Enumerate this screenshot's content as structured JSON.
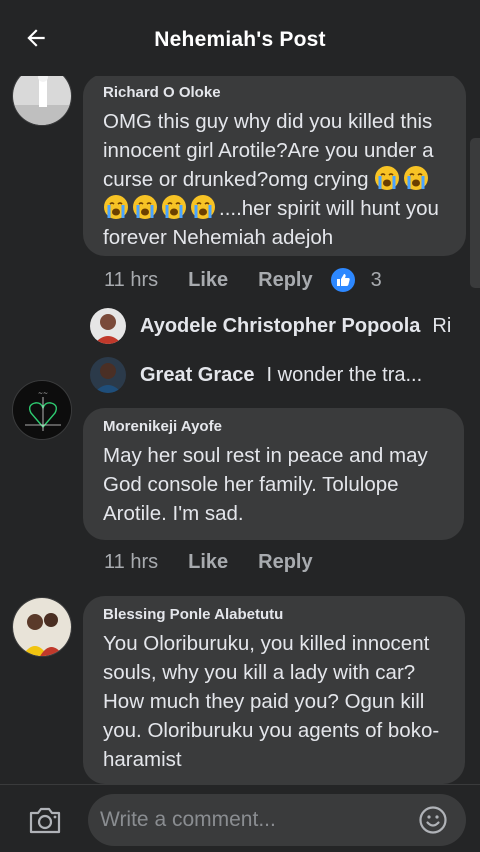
{
  "header": {
    "title": "Nehemiah's Post",
    "back_icon": "back-arrow-icon"
  },
  "comments": [
    {
      "author": "Richard O Oloke",
      "text_before_emoji": "OMG this guy why did you killed this innocent girl Arotile?Are you under a curse or drunked?omg crying",
      "emoji": "loudly-crying-face",
      "emoji_count": 6,
      "text_after_emoji": "....her spirit will hunt you forever Nehemiah adejoh",
      "time": "11 hrs",
      "like_label": "Like",
      "reply_label": "Reply",
      "reaction_count": "3",
      "replies": [
        {
          "name": "Ayodele Christopher Popoola",
          "text": "Ri"
        },
        {
          "name": "Great Grace",
          "text": "I wonder the tra..."
        }
      ]
    },
    {
      "author": "Morenikeji Ayofe",
      "text": "May her soul rest in peace and may God console her family. Tolulope Arotile. I'm sad.",
      "time": "11 hrs",
      "like_label": "Like",
      "reply_label": "Reply"
    },
    {
      "author": "Blessing Ponle Alabetutu",
      "text": "You Oloriburuku,  you killed innocent souls,  why you kill a lady with car? How much they paid you? Ogun kill you. Oloriburuku you agents of boko-haramist"
    }
  ],
  "footer": {
    "placeholder": "Write a comment...",
    "camera_icon": "camera-icon",
    "emoji_icon": "smiley-icon"
  },
  "colors": {
    "background": "#242526",
    "bubble": "#3a3b3c",
    "text": "#e4e6eb",
    "secondary_text": "#a8abaf",
    "like_blue": "#2d88ff"
  }
}
